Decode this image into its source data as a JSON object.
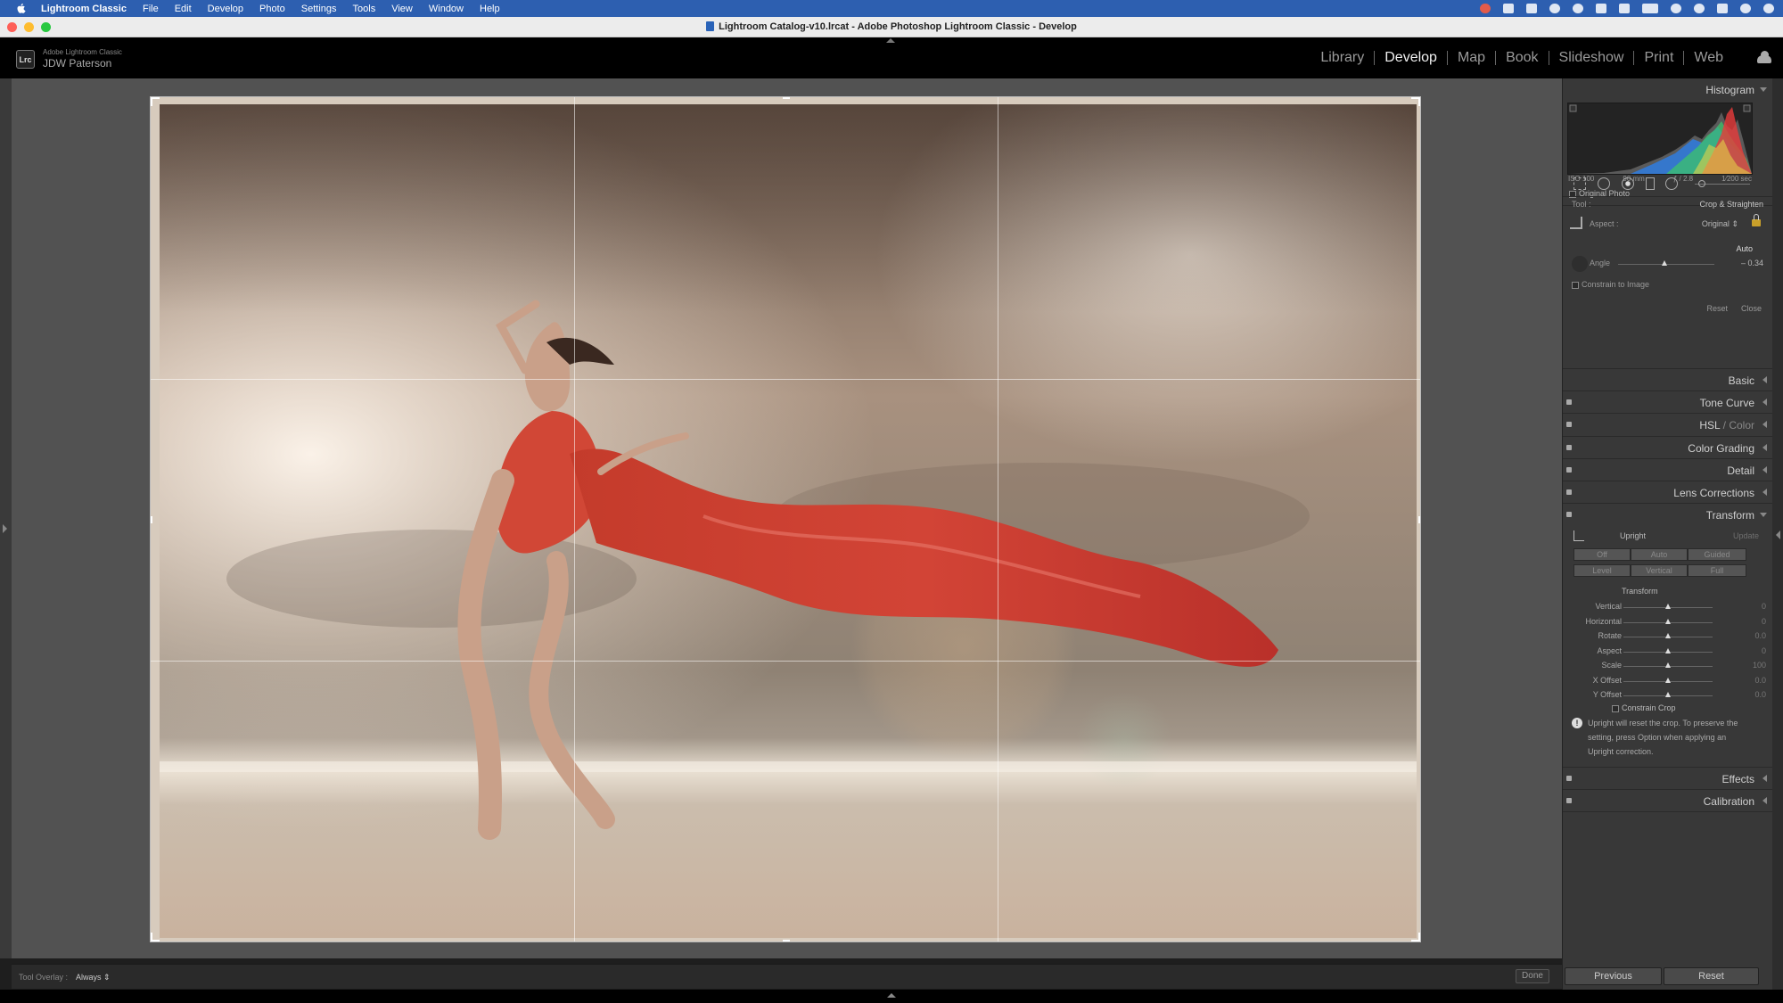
{
  "menubar": {
    "app_name": "Lightroom Classic",
    "items": [
      "File",
      "Edit",
      "Develop",
      "Photo",
      "Settings",
      "Tools",
      "View",
      "Window",
      "Help"
    ]
  },
  "window": {
    "title": "Lightroom Catalog-v10.lrcat - Adobe Photoshop Lightroom Classic - Develop"
  },
  "identity": {
    "badge": "Lrc",
    "product": "Adobe Lightroom Classic",
    "user": "JDW Paterson"
  },
  "modules": [
    {
      "label": "Library",
      "active": false
    },
    {
      "label": "Develop",
      "active": true
    },
    {
      "label": "Map",
      "active": false
    },
    {
      "label": "Book",
      "active": false
    },
    {
      "label": "Slideshow",
      "active": false
    },
    {
      "label": "Print",
      "active": false
    },
    {
      "label": "Web",
      "active": false
    }
  ],
  "toolbar": {
    "tool_overlay_label": "Tool Overlay :",
    "tool_overlay_value": "Always",
    "done_label": "Done"
  },
  "histogram": {
    "title": "Histogram",
    "iso": "ISO 100",
    "focal": "90 mm",
    "aperture": "ƒ / 2.8",
    "shutter": "1⁄200 sec",
    "original_photo_label": "Original Photo"
  },
  "crop": {
    "tool_label": "Tool :",
    "tool_name": "Crop & Straighten",
    "aspect_label": "Aspect :",
    "aspect_value": "Original",
    "auto_label": "Auto",
    "angle_label": "Angle",
    "angle_value": "– 0.34",
    "angle_fraction": 0.48,
    "constrain_label": "Constrain to Image",
    "reset_label": "Reset",
    "close_label": "Close"
  },
  "panels": {
    "basic": "Basic",
    "tone_curve": "Tone Curve",
    "hsl": "HSL",
    "hsl_sep": " / ",
    "color": "Color",
    "color_grading": "Color Grading",
    "detail": "Detail",
    "lens": "Lens Corrections",
    "transform": "Transform",
    "effects": "Effects",
    "calibration": "Calibration"
  },
  "transform": {
    "upright_label": "Upright",
    "update_label": "Update",
    "buttons_row1": [
      "Off",
      "Auto",
      "Guided"
    ],
    "buttons_row2": [
      "Level",
      "Vertical",
      "Full"
    ],
    "section_label": "Transform",
    "sliders": [
      {
        "label": "Vertical",
        "value": "0",
        "fraction": 0.5
      },
      {
        "label": "Horizontal",
        "value": "0",
        "fraction": 0.5
      },
      {
        "label": "Rotate",
        "value": "0.0",
        "fraction": 0.5
      },
      {
        "label": "Aspect",
        "value": "0",
        "fraction": 0.5
      },
      {
        "label": "Scale",
        "value": "100",
        "fraction": 0.5
      },
      {
        "label": "X Offset",
        "value": "0.0",
        "fraction": 0.5
      },
      {
        "label": "Y Offset",
        "value": "0.0",
        "fraction": 0.5
      }
    ],
    "constrain_crop_label": "Constrain Crop",
    "note_line1": "Upright will reset the crop. To preserve the",
    "note_line2": "setting, press Option when applying an",
    "note_line3": "Upright correction."
  },
  "footer": {
    "previous_label": "Previous",
    "reset_label": "Reset"
  }
}
